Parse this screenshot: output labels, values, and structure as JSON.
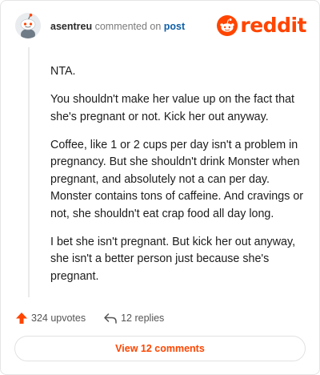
{
  "header": {
    "username": "asentreu",
    "action": "commented on",
    "link_text": "post",
    "brand": "reddit"
  },
  "comment": {
    "paragraphs": [
      "NTA.",
      "You shouldn't make her value up on the fact that she's pregnant or not. Kick her out anyway.",
      "Coffee, like 1 or 2 cups per day isn't a problem in pregnancy. But she shouldn't drink Monster when pregnant, and absolutely not a can per day. Monster contains tons of caffeine. And cravings or not, she shouldn't eat crap food all day long.",
      "I bet she isn't pregnant. But kick her out anyway, she isn't a better person just because she's pregnant."
    ]
  },
  "actions": {
    "upvotes_label": "324 upvotes",
    "replies_label": "12 replies"
  },
  "view_comments_label": "View 12 comments",
  "colors": {
    "brand": "#ff4500",
    "link": "#0f5fa6",
    "text": "#1c1c1c",
    "muted": "#7a7a7a"
  },
  "icons": {
    "avatar": "snoo-avatar-icon",
    "brand": "reddit-snoo-icon",
    "upvote": "upvote-arrow-icon",
    "reply": "reply-arrow-icon"
  }
}
